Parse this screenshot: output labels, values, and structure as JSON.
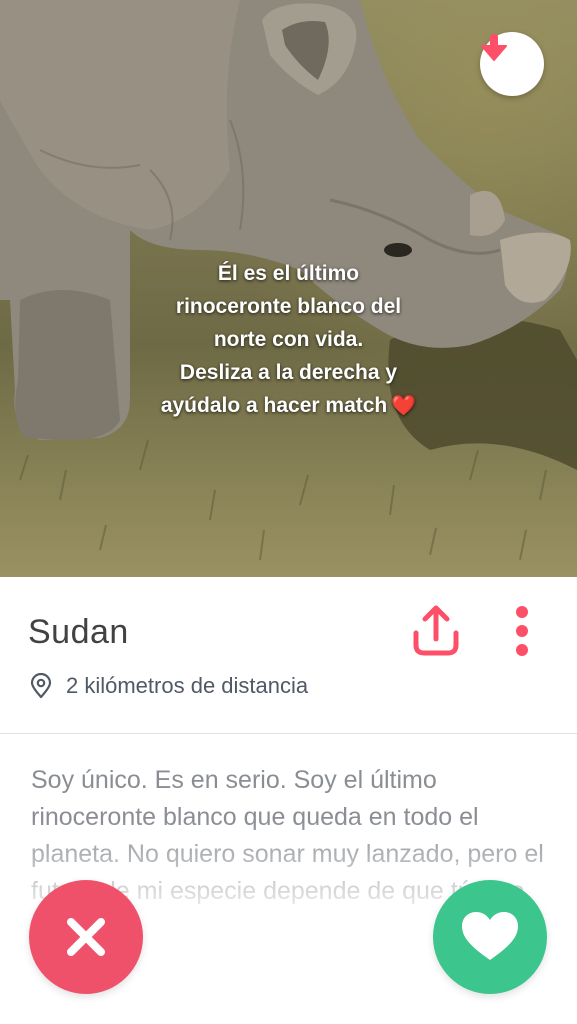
{
  "photo": {
    "caption_lines": [
      "Él es el último",
      "rinoceronte blanco del",
      "norte con vida.",
      "Desliza a la derecha y",
      "ayúdalo a hacer match"
    ],
    "caption_emoji": "❤️"
  },
  "collapse_button": {
    "icon": "arrow-down-icon"
  },
  "profile": {
    "name": "Sudan",
    "distance": "2 kilómetros de distancia",
    "location_icon": "location-pin-icon"
  },
  "actions": {
    "share_icon": "share-icon",
    "more_icon": "more-vertical-icon",
    "nope_icon": "close-icon",
    "like_icon": "heart-icon"
  },
  "bio": "Soy único. Es en serio. Soy el último rinoceronte blanco que queda en todo el planeta. No quiero sonar muy lanzado, pero el futuro de mi especie depende de que tú y yo nos junt",
  "colors": {
    "accent_pink": "#fd5068",
    "nope_bg": "#f0516a",
    "like_bg": "#3cc58d",
    "name_text": "#424242",
    "bio_text": "#8a8e93"
  }
}
